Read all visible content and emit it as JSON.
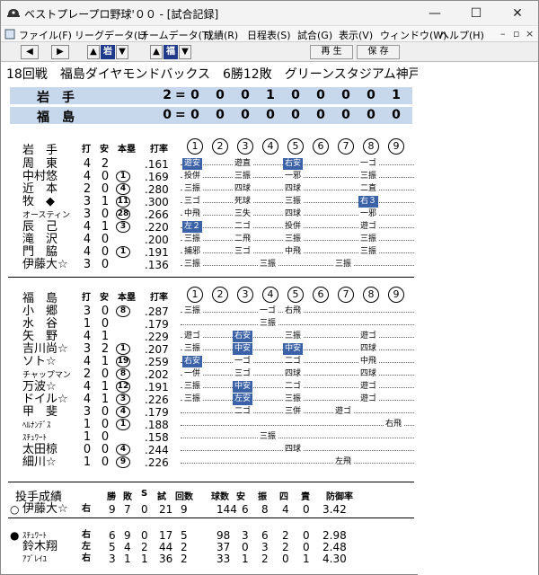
{
  "window": {
    "title": "ベストプレープロ野球'００ - [試合記録]",
    "min": "—",
    "max": "☐",
    "close": "✕"
  },
  "menu": [
    "ファイル(F)",
    "リーグデータ(L)",
    "チームデータ(T)",
    "成績(R)",
    "日程表(S)",
    "試合(G)",
    "表示(V)",
    "ウィンドウ(W)",
    "ヘルプ(H)"
  ],
  "mdi": {
    "min": "–",
    "restore": "▫",
    "close": "×"
  },
  "toolbar": {
    "prev": "◀",
    "next": "▶",
    "iwate": "岩",
    "fukushima": "福",
    "up": "▲",
    "down": "▼",
    "replay": "再 生",
    "save": "保 存"
  },
  "game_title": "18回戦　福島ダイヤモンドバックス　6勝12敗　グリーンスタジアム神戸",
  "scoreboard": [
    {
      "team": "岩手",
      "total": "2",
      "eq": "=",
      "innings": [
        "0",
        "0",
        "0",
        "1",
        "0",
        "0",
        "0",
        "0",
        "1"
      ]
    },
    {
      "team": "福島",
      "total": "0",
      "eq": "=",
      "innings": [
        "0",
        "0",
        "0",
        "0",
        "0",
        "0",
        "0",
        "0",
        "0"
      ]
    }
  ],
  "batting_headers": {
    "da": "打",
    "an": "安",
    "hr": "本塁",
    "avg": "打率",
    "innings": [
      "1",
      "2",
      "3",
      "4",
      "5",
      "6",
      "7",
      "8",
      "9"
    ]
  },
  "iwate": {
    "label": "岩　手",
    "players": [
      {
        "name": "周　東",
        "ab": "4",
        "h": "2",
        "hr": "",
        "avg": ".161",
        "res": [
          [
            "遊安",
            1
          ],
          [
            "遊直",
            0
          ],
          [
            "右安",
            1
          ],
          [
            "一ゴ",
            0
          ]
        ]
      },
      {
        "name": "中村悠",
        "ab": "4",
        "h": "0",
        "hr": "1",
        "avg": ".169",
        "res": [
          [
            "投併",
            0
          ],
          [
            "三振",
            0
          ],
          [
            "一邪",
            0
          ],
          [
            "三振",
            0
          ]
        ]
      },
      {
        "name": "近　本",
        "ab": "2",
        "h": "0",
        "hr": "4",
        "avg": ".280",
        "res": [
          [
            "三振",
            0
          ],
          [
            "四球",
            0
          ],
          [
            "四球",
            0
          ],
          [
            "二直",
            0
          ]
        ]
      },
      {
        "name": "牧　◆",
        "ab": "3",
        "h": "1",
        "hr": "11",
        "avg": ".300",
        "res": [
          [
            "三ゴ",
            0
          ],
          [
            "死球",
            0
          ],
          [
            "三振",
            0
          ],
          [
            "右３",
            1
          ]
        ]
      },
      {
        "name": "オースティン",
        "ab": "3",
        "h": "0",
        "hr": "28",
        "avg": ".266",
        "res": [
          [
            "中飛",
            0
          ],
          [
            "三失",
            0
          ],
          [
            "四球",
            0
          ],
          [
            "一邪",
            0
          ]
        ]
      },
      {
        "name": "辰　己",
        "ab": "4",
        "h": "1",
        "hr": "3",
        "avg": ".220",
        "res": [
          [
            "左２",
            1
          ],
          [
            "二ゴ",
            0
          ],
          [
            "投併",
            0
          ],
          [
            "遊ゴ",
            0
          ]
        ]
      },
      {
        "name": "滝　沢",
        "ab": "4",
        "h": "0",
        "hr": "",
        "avg": ".200",
        "res": [
          [
            "三振",
            0
          ],
          [
            "二飛",
            0
          ],
          [
            "三振",
            0
          ],
          [
            "三振",
            0
          ]
        ]
      },
      {
        "name": "門　脇",
        "ab": "4",
        "h": "0",
        "hr": "1",
        "avg": ".191",
        "res": [
          [
            "捕邪",
            0
          ],
          [
            "三ゴ",
            0
          ],
          [
            "中飛",
            0
          ],
          [
            "三振",
            0
          ]
        ]
      },
      {
        "name": "伊藤大☆",
        "ab": "3",
        "h": "0",
        "hr": "",
        "avg": ".136",
        "res": [
          [
            "三振",
            0
          ],
          [
            "三振",
            0
          ],
          [
            "三振",
            0
          ]
        ]
      }
    ]
  },
  "fukushima": {
    "label": "福　島",
    "players": [
      {
        "name": "小　郷",
        "ab": "3",
        "h": "0",
        "hr": "8",
        "avg": ".287",
        "res": [
          [
            "三振",
            0
          ],
          [
            "一ゴ",
            0
          ],
          [
            "右飛",
            0
          ]
        ]
      },
      {
        "name": "水　谷",
        "ab": "1",
        "h": "0",
        "hr": "",
        "avg": ".179",
        "res": [
          [
            "三振",
            0
          ]
        ]
      },
      {
        "name": "矢　野",
        "ab": "4",
        "h": "1",
        "hr": "",
        "avg": ".229",
        "res": [
          [
            "遊ゴ",
            0
          ],
          [
            "右安",
            1
          ],
          [
            "三振",
            0
          ],
          [
            "遊ゴ",
            0
          ]
        ]
      },
      {
        "name": "吉川尚☆",
        "ab": "3",
        "h": "2",
        "hr": "1",
        "avg": ".207",
        "res": [
          [
            "三振",
            0
          ],
          [
            "中安",
            1
          ],
          [
            "中安",
            1
          ],
          [
            "四球",
            0
          ]
        ]
      },
      {
        "name": "ソト☆",
        "ab": "4",
        "h": "1",
        "hr": "19",
        "avg": ".259",
        "res": [
          [
            "右安",
            1
          ],
          [
            "一ゴ",
            0
          ],
          [
            "二ゴ",
            0
          ],
          [
            "中飛",
            0
          ]
        ]
      },
      {
        "name": "チャップマン",
        "ab": "2",
        "h": "0",
        "hr": "8",
        "avg": ".202",
        "res": [
          [
            "一併",
            0
          ],
          [
            "三ゴ",
            0
          ],
          [
            "四球",
            0
          ],
          [
            "四球",
            0
          ]
        ]
      },
      {
        "name": "万波☆",
        "ab": "4",
        "h": "1",
        "hr": "12",
        "avg": ".191",
        "res": [
          [
            "三振",
            0
          ],
          [
            "中安",
            1
          ],
          [
            "二ゴ",
            0
          ],
          [
            "遊ゴ",
            0
          ]
        ]
      },
      {
        "name": "ドイル☆",
        "ab": "4",
        "h": "1",
        "hr": "3",
        "avg": ".226",
        "res": [
          [
            "三振",
            0
          ],
          [
            "左安",
            1
          ],
          [
            "三振",
            0
          ],
          [
            "遊ゴ",
            0
          ]
        ]
      },
      {
        "name": "甲　斐",
        "ab": "3",
        "h": "0",
        "hr": "4",
        "avg": ".179",
        "res": [
          [
            "二ゴ",
            0
          ],
          [
            "三併",
            0
          ],
          [
            "遊ゴ",
            0
          ]
        ]
      },
      {
        "name": "ﾍﾙﾅﾝﾃﾞｽ",
        "ab": "1",
        "h": "0",
        "hr": "1",
        "avg": ".188",
        "res": [
          [
            "右飛",
            0
          ]
        ]
      },
      {
        "name": "ｽﾁｭﾜｰﾄ",
        "ab": "1",
        "h": "0",
        "hr": "",
        "avg": ".158",
        "res": [
          [
            "三振",
            0
          ]
        ]
      },
      {
        "name": "太田椋",
        "ab": "0",
        "h": "0",
        "hr": "4",
        "avg": ".244",
        "res": [
          [
            "四球",
            0
          ]
        ]
      },
      {
        "name": "細川☆",
        "ab": "1",
        "h": "0",
        "hr": "9",
        "avg": ".226",
        "res": [
          [
            "左飛",
            0
          ]
        ]
      }
    ]
  },
  "pitching": {
    "label": "投手成績",
    "headers": [
      "勝",
      "敗",
      "S",
      "試",
      "回数",
      "球数",
      "安",
      "振",
      "四",
      "責",
      "防御率"
    ],
    "rows": [
      {
        "mark": "○",
        "name": "伊藤大☆",
        "hand": "右",
        "vals": [
          "9",
          "7",
          "0",
          "21",
          "9",
          "144",
          "6",
          "8",
          "4",
          "0",
          "3.42"
        ]
      },
      {
        "mark": "●",
        "name": "ｽﾁｭﾜｰﾄ",
        "hand": "右",
        "vals": [
          "6",
          "9",
          "0",
          "17",
          "5",
          "98",
          "3",
          "6",
          "2",
          "0",
          "2.98"
        ]
      },
      {
        "mark": "",
        "name": "鈴木翔",
        "hand": "左",
        "vals": [
          "5",
          "4",
          "2",
          "44",
          "2",
          "37",
          "0",
          "3",
          "2",
          "0",
          "2.48"
        ]
      },
      {
        "mark": "",
        "name": "ｱﾌﾞﾚｲﾕ",
        "hand": "右",
        "vals": [
          "3",
          "1",
          "1",
          "36",
          "2",
          "33",
          "1",
          "2",
          "0",
          "1",
          "4.30"
        ]
      }
    ]
  }
}
